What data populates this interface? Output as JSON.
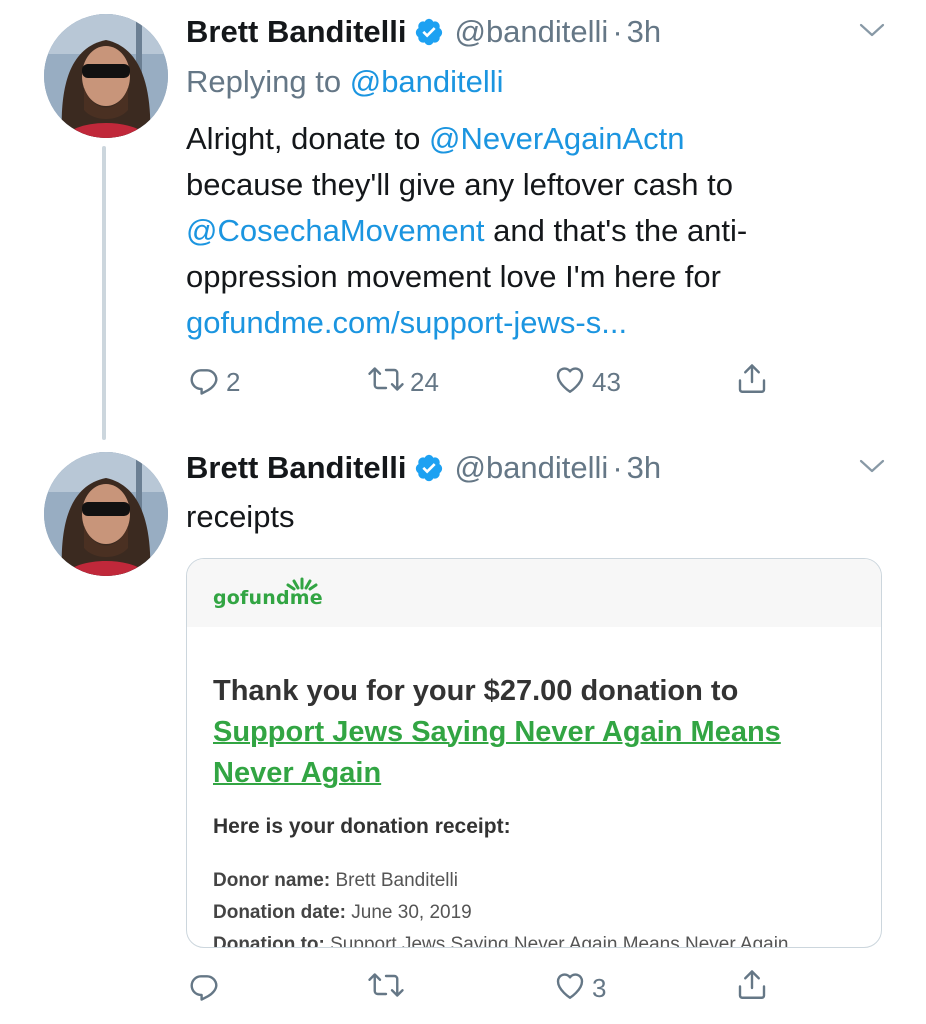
{
  "tweets": [
    {
      "author": {
        "name": "Brett Banditelli",
        "handle": "@banditelli",
        "verified": true
      },
      "separator": "·",
      "time": "3h",
      "replying_prefix": "Replying to",
      "replying_to": "@banditelli",
      "body": {
        "line1_prefix": "Alright, donate to ",
        "line1_mention": "@NeverAgainActn",
        "line2": "because they'll give any leftover cash to",
        "line3_mention": "@CosechaMovement",
        "line3_suffix": " and that's the anti-",
        "line4": "oppression movement love I'm here for",
        "line5_link": "gofundme.com/support-jews-s..."
      },
      "actions": {
        "replies": "2",
        "retweets": "24",
        "likes": "43"
      }
    },
    {
      "author": {
        "name": "Brett Banditelli",
        "handle": "@banditelli",
        "verified": true
      },
      "separator": "·",
      "time": "3h",
      "body_text": "receipts",
      "card": {
        "logo_text": "gofundme",
        "heading_prefix": "Thank you for your $27.00 donation to",
        "heading_link": "Support Jews Saying Never Again Means Never Again",
        "subheading": "Here is your donation receipt:",
        "rows": [
          {
            "label": "Donor name:",
            "value": " Brett Banditelli"
          },
          {
            "label": "Donation date:",
            "value": " June 30, 2019"
          },
          {
            "label": "Donation to:",
            "value": " Support Jews Saying Never Again Means Never Again"
          }
        ]
      },
      "actions": {
        "replies": "",
        "retweets": "",
        "likes": "3"
      }
    }
  ],
  "colors": {
    "text_primary": "#14171a",
    "text_secondary": "#657786",
    "link": "#1b95e0",
    "verified": "#1da1f2",
    "gofundme_green": "#32a543",
    "thread_line": "#ccd6dd"
  },
  "icons": [
    "verified-badge-icon",
    "chevron-down-icon",
    "reply-icon",
    "retweet-icon",
    "like-icon",
    "share-icon",
    "gofundme-logo"
  ]
}
